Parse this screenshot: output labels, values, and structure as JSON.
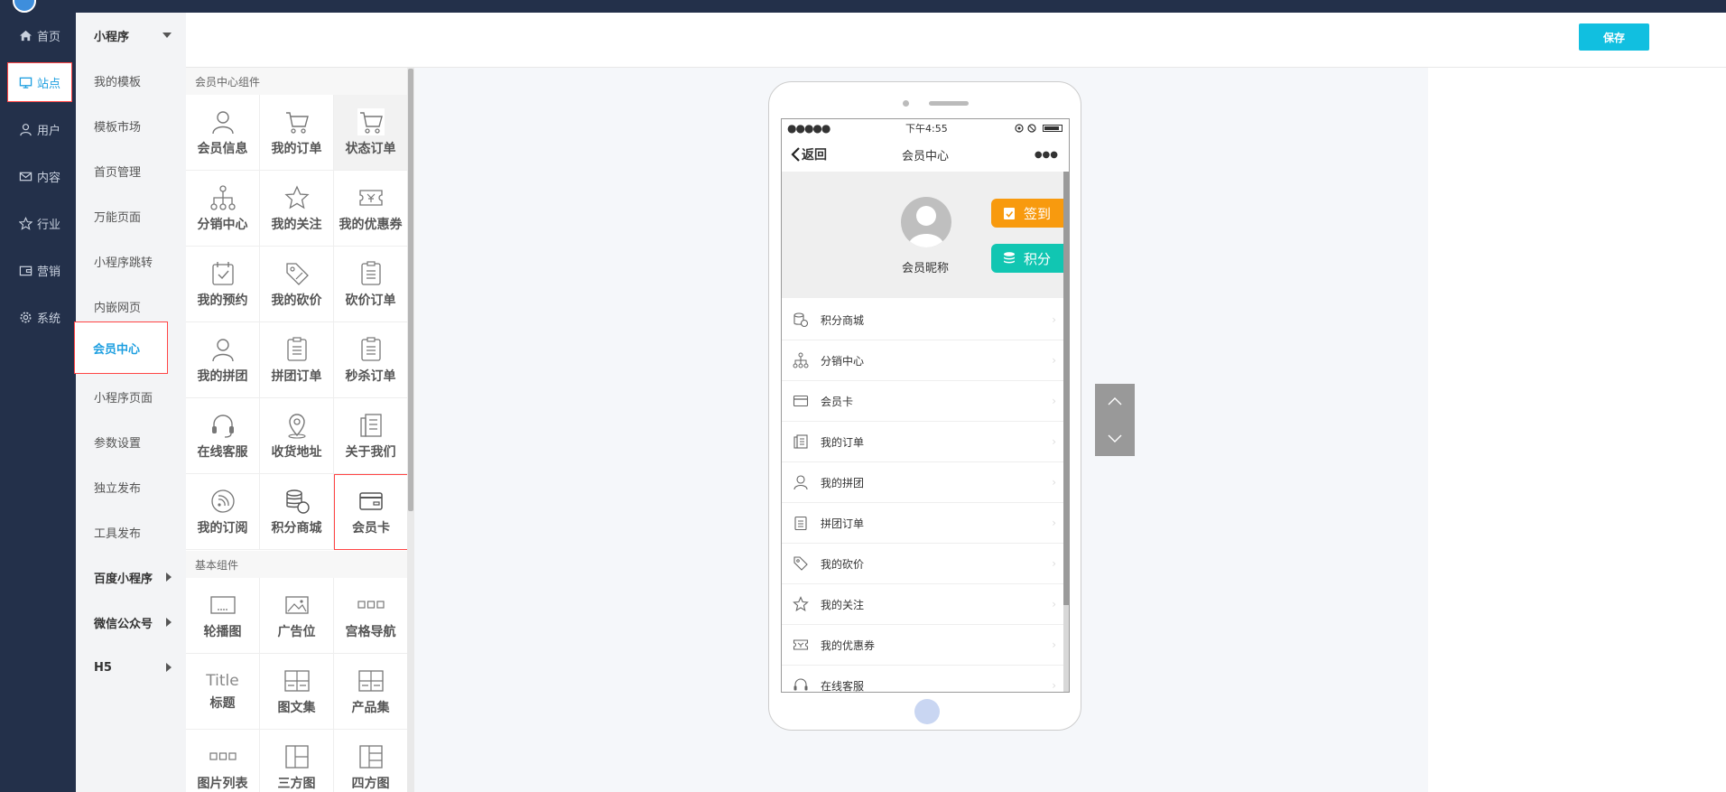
{
  "app": {
    "title": ""
  },
  "main_nav": [
    {
      "label": "首页",
      "icon": "home-icon"
    },
    {
      "label": "站点",
      "icon": "monitor-icon"
    },
    {
      "label": "用户",
      "icon": "user-icon"
    },
    {
      "label": "内容",
      "icon": "mail-icon"
    },
    {
      "label": "行业",
      "icon": "star-icon"
    },
    {
      "label": "营销",
      "icon": "wallet-icon"
    },
    {
      "label": "系统",
      "icon": "gear-icon"
    }
  ],
  "sub_nav": [
    {
      "label": "小程序"
    },
    {
      "label": "我的模板"
    },
    {
      "label": "模板市场"
    },
    {
      "label": "首页管理"
    },
    {
      "label": "万能页面"
    },
    {
      "label": "小程序跳转"
    },
    {
      "label": "内嵌网页"
    },
    {
      "label": "会员中心"
    },
    {
      "label": "小程序页面"
    },
    {
      "label": "参数设置"
    },
    {
      "label": "独立发布"
    },
    {
      "label": "工具发布"
    },
    {
      "label": "百度小程序"
    },
    {
      "label": "微信公众号"
    },
    {
      "label": "H5"
    }
  ],
  "toolbar": {
    "save_label": "保存"
  },
  "panel": {
    "member_section": "会员中心组件",
    "basic_section": "基本组件",
    "member_components": [
      {
        "label": "会员信息",
        "icon": "person-icon"
      },
      {
        "label": "我的订单",
        "icon": "cart-icon"
      },
      {
        "label": "状态订单",
        "icon": "cart-icon"
      },
      {
        "label": "分销中心",
        "icon": "network-icon"
      },
      {
        "label": "我的关注",
        "icon": "star-icon"
      },
      {
        "label": "我的优惠券",
        "icon": "coupon-icon"
      },
      {
        "label": "我的预约",
        "icon": "calendar-check-icon"
      },
      {
        "label": "我的砍价",
        "icon": "tag-icon"
      },
      {
        "label": "砍价订单",
        "icon": "clipboard-icon"
      },
      {
        "label": "我的拼团",
        "icon": "person-icon"
      },
      {
        "label": "拼团订单",
        "icon": "clipboard-icon"
      },
      {
        "label": "秒杀订单",
        "icon": "clipboard-icon"
      },
      {
        "label": "在线客服",
        "icon": "headset-icon"
      },
      {
        "label": "收货地址",
        "icon": "location-icon"
      },
      {
        "label": "关于我们",
        "icon": "document-icon"
      },
      {
        "label": "我的订阅",
        "icon": "rss-icon"
      },
      {
        "label": "积分商城",
        "icon": "coins-icon"
      },
      {
        "label": "会员卡",
        "icon": "card-icon"
      }
    ],
    "basic_components": [
      {
        "label": "轮播图",
        "icon": "carousel-icon"
      },
      {
        "label": "广告位",
        "icon": "image-icon"
      },
      {
        "label": "宫格导航",
        "icon": "grid-nav-icon"
      },
      {
        "label": "标题",
        "icon": "title-icon",
        "text": "Title"
      },
      {
        "label": "图文集",
        "icon": "article-grid-icon"
      },
      {
        "label": "产品集",
        "icon": "product-grid-icon"
      },
      {
        "label": "图片列表",
        "icon": "image-list-icon"
      },
      {
        "label": "三方图",
        "icon": "three-grid-icon"
      },
      {
        "label": "四方图",
        "icon": "four-grid-icon"
      }
    ]
  },
  "phone": {
    "status_time": "下午4:55",
    "status_signal": "●●●●●",
    "back_label": "返回",
    "page_title": "会员中心",
    "more": "●●●",
    "nickname": "会员昵称",
    "sign_in_label": "签到",
    "points_label": "积分",
    "menu": [
      {
        "label": "积分商城",
        "icon": "coins-icon"
      },
      {
        "label": "分销中心",
        "icon": "network-icon"
      },
      {
        "label": "会员卡",
        "icon": "card-icon"
      },
      {
        "label": "我的订单",
        "icon": "document-icon"
      },
      {
        "label": "我的拼团",
        "icon": "person-icon"
      },
      {
        "label": "拼团订单",
        "icon": "clipboard-icon"
      },
      {
        "label": "我的砍价",
        "icon": "tag-icon"
      },
      {
        "label": "我的关注",
        "icon": "star-icon"
      },
      {
        "label": "我的优惠券",
        "icon": "coupon-icon"
      },
      {
        "label": "在线客服",
        "icon": "headset-icon"
      }
    ]
  },
  "colors": {
    "nav_bg": "#23304a",
    "accent": "#1e9fe0",
    "save_button": "#11bfe0",
    "sign_in": "#f89a0e",
    "points": "#11c6b2",
    "highlight_border": "#ff4444"
  }
}
